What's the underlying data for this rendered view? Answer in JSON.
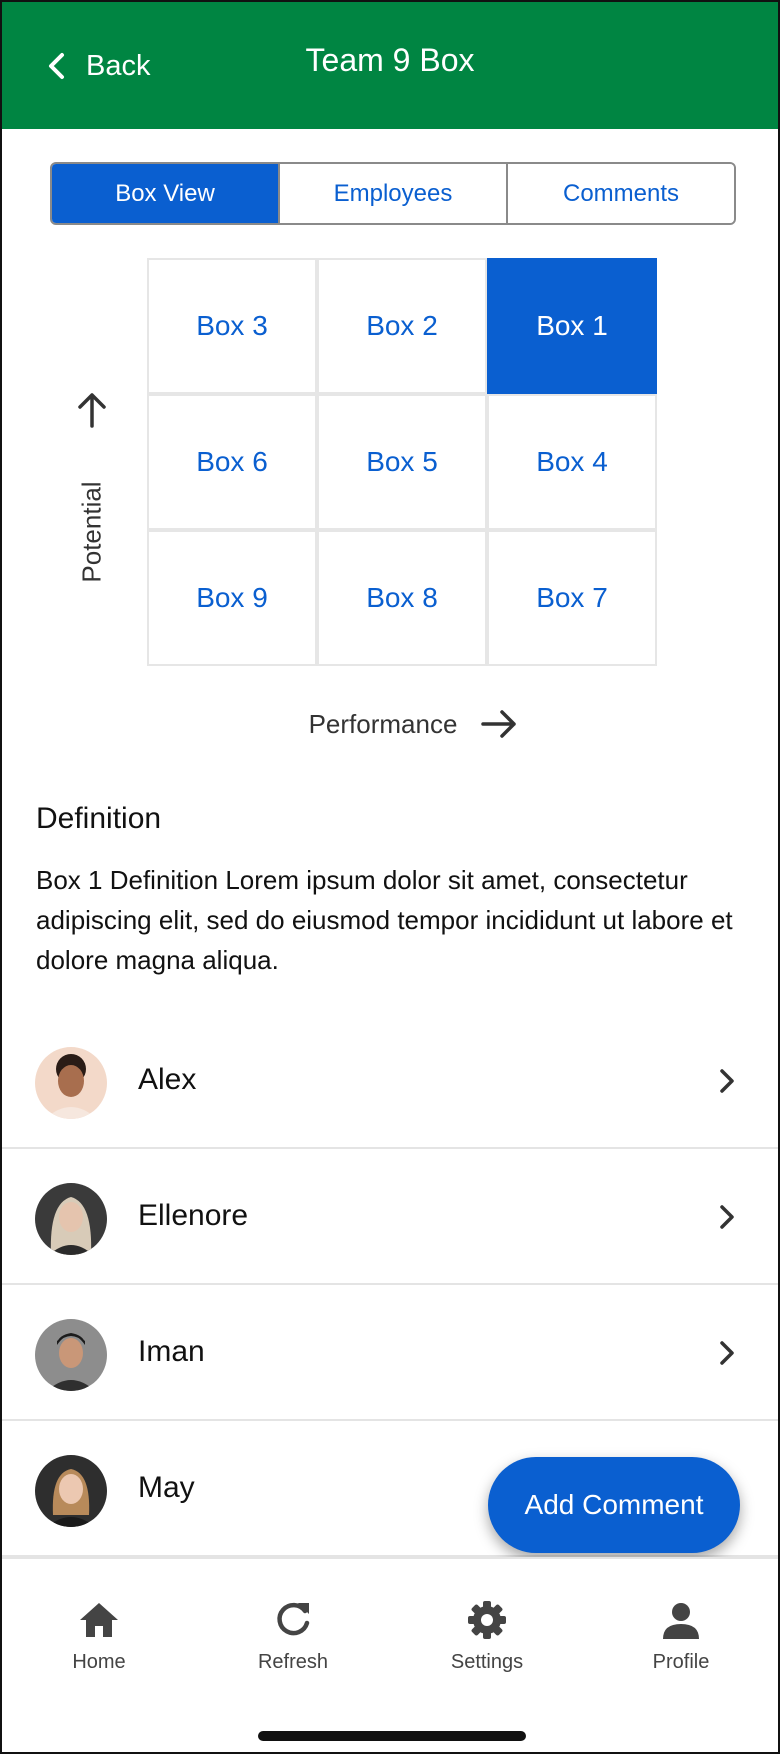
{
  "header": {
    "back_label": "Back",
    "title": "Team 9 Box",
    "color": "#008542"
  },
  "tabs": [
    {
      "label": "Box View",
      "active": true
    },
    {
      "label": "Employees",
      "active": false
    },
    {
      "label": "Comments",
      "active": false
    }
  ],
  "grid": {
    "rows": [
      [
        "Box 3",
        "Box 2",
        "Box 1"
      ],
      [
        "Box 6",
        "Box 5",
        "Box 4"
      ],
      [
        "Box 9",
        "Box 8",
        "Box 7"
      ]
    ],
    "selected": "Box 1",
    "accent": "#0a5fd0"
  },
  "axes": {
    "y_label": "Potential",
    "x_label": "Performance"
  },
  "definition": {
    "title": "Definition",
    "text": "Box 1 Definition Lorem ipsum dolor sit amet, consectetur adipiscing elit, sed do eiusmod tempor incididunt ut labore et dolore magna aliqua."
  },
  "employees": [
    {
      "name": "Alex"
    },
    {
      "name": "Ellenore"
    },
    {
      "name": "Iman"
    },
    {
      "name": "May"
    }
  ],
  "fab": {
    "label": "Add Comment"
  },
  "bottom_nav": [
    {
      "label": "Home",
      "icon": "home-icon"
    },
    {
      "label": "Refresh",
      "icon": "refresh-icon"
    },
    {
      "label": "Settings",
      "icon": "settings-icon"
    },
    {
      "label": "Profile",
      "icon": "profile-icon"
    }
  ]
}
